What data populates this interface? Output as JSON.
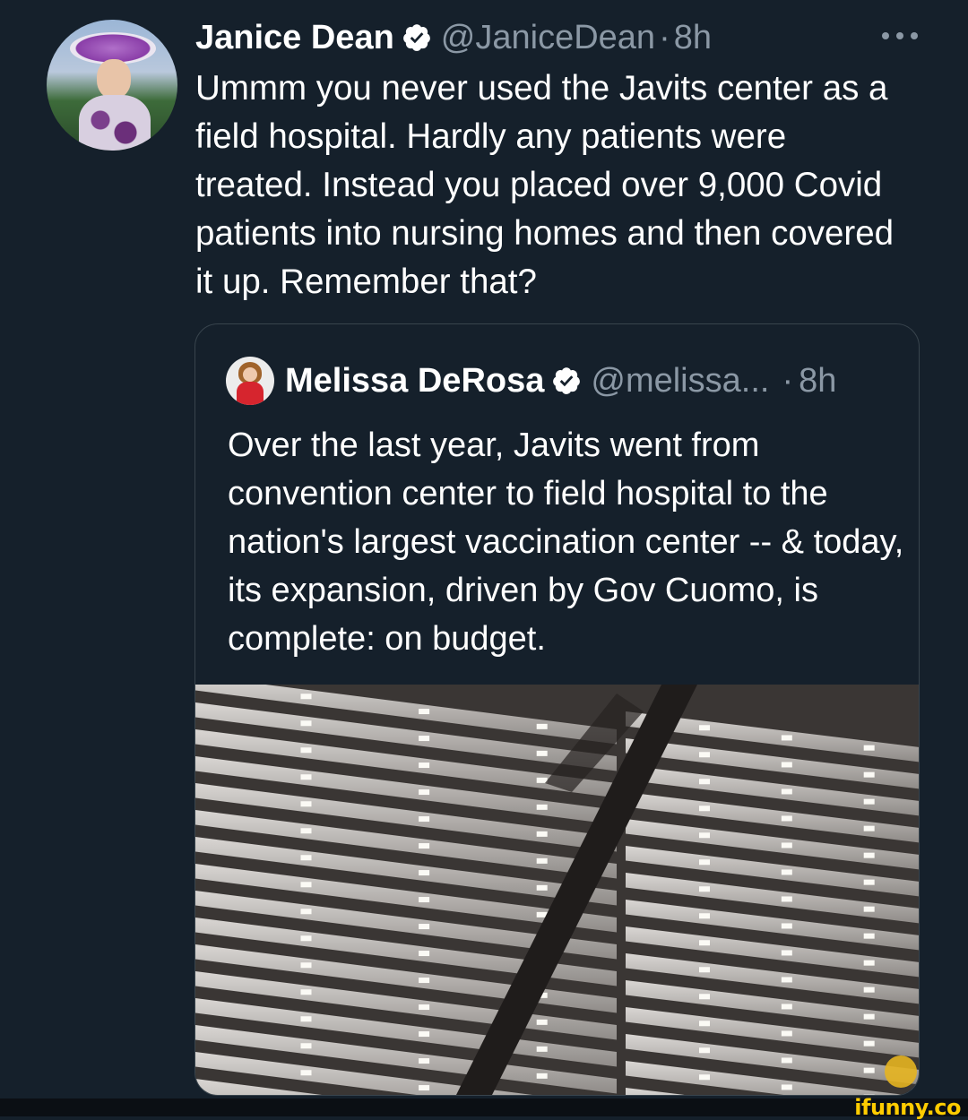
{
  "tweet": {
    "author_name": "Janice Dean",
    "author_handle": "@JaniceDean",
    "separator": "·",
    "time": "8h",
    "text": "Ummm you never used the Javits center as a field hospital.  Hardly any patients were treated. Instead you placed over 9,000 Covid patients into nursing homes and then covered it up. Remember that?"
  },
  "quote": {
    "author_name": "Melissa DeRosa",
    "author_handle": "@melissa...",
    "separator": "·",
    "time": "8h",
    "text": "Over the last year, Javits went from convention center to field hospital to the nation's largest vaccination center -- & today, its expansion, driven by Gov Cuomo, is complete: on budget."
  },
  "watermark": "ifunny.co",
  "colors": {
    "background": "#15202b",
    "secondary_text": "#8b98a5",
    "border": "#38444d",
    "watermark": "#ffcc00"
  },
  "icons": {
    "verified": "verified-badge-icon",
    "more": "more-options-icon"
  }
}
